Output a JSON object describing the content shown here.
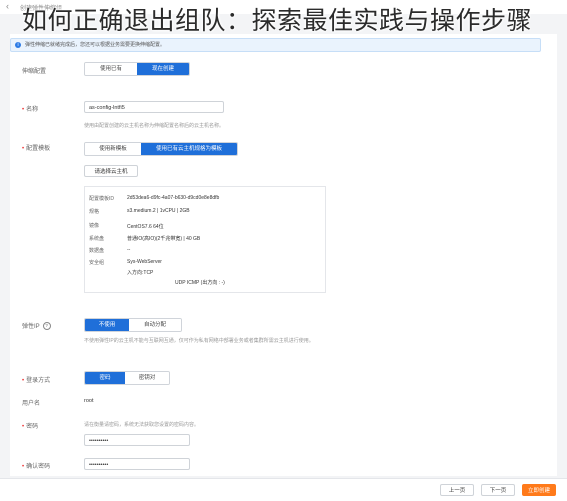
{
  "overlay_title": "如何正确退出组队：探索最佳实践与操作步骤",
  "header": {
    "breadcrumb": "创建弹性伸缩组"
  },
  "notice": {
    "text": "弹性伸缩已就绪完成后，您还可以根据业务需要更换伸缩配置。"
  },
  "scaling_config": {
    "label": "伸缩配置",
    "options": [
      "使用已有",
      "现在创建"
    ],
    "active_index": 1
  },
  "name": {
    "label": "名称",
    "value": "as-config-lntfi5",
    "hint": "使用由配置创建的云主机名称为伸缩配置名称后的云主机名称。"
  },
  "config_template": {
    "label": "配置模板",
    "options": [
      "使用新模板",
      "使用已有云主机规格为模板"
    ],
    "active_index": 1,
    "select_button": "请选择云主机"
  },
  "template_details": {
    "rows": [
      {
        "key": "配置模板ID",
        "value": "2d53dea6-d9fc-4a07-b630-d9cd0e8e8dfb"
      },
      {
        "key": "规格",
        "value": "s3.medium.2 | 1vCPU | 2GB"
      },
      {
        "key": "镜像",
        "value": "CentOS7.6 64位"
      },
      {
        "key": "系统盘",
        "value": "普通IO(高IO)(2千兆带宽) | 40 GB"
      },
      {
        "key": "数据盘",
        "value": "--"
      },
      {
        "key": "安全组",
        "value": "Sys-WebServer"
      },
      {
        "key": "",
        "value": "入方向:TCP"
      },
      {
        "key": "",
        "value": "UDP       ICMP (出方向 : -)"
      }
    ]
  },
  "elastic_ip": {
    "label": "弹性IP",
    "options": [
      "不使用",
      "自动分配"
    ],
    "active_index": 0,
    "hint": "不使用弹性IP的云主机不能与互联网互通，仅可作为私有网络中部署业务或者集群所需云主机进行使用。"
  },
  "login_method": {
    "label": "登录方式",
    "options": [
      "密码",
      "密钥对"
    ],
    "active_index": 0
  },
  "username": {
    "label": "用户名",
    "value": "root"
  },
  "password": {
    "label": "密码",
    "hint": "请在衡量请密码，系统无法获取您设置的密码内容。",
    "value": "••••••••••"
  },
  "confirm_password": {
    "label": "确认密码",
    "value": "••••••••••"
  },
  "footer": {
    "prev": "上一页",
    "next": "下一页",
    "create": "立即创建"
  },
  "colors": {
    "primary": "#1f6fd9",
    "accent": "#ff7a1a"
  }
}
